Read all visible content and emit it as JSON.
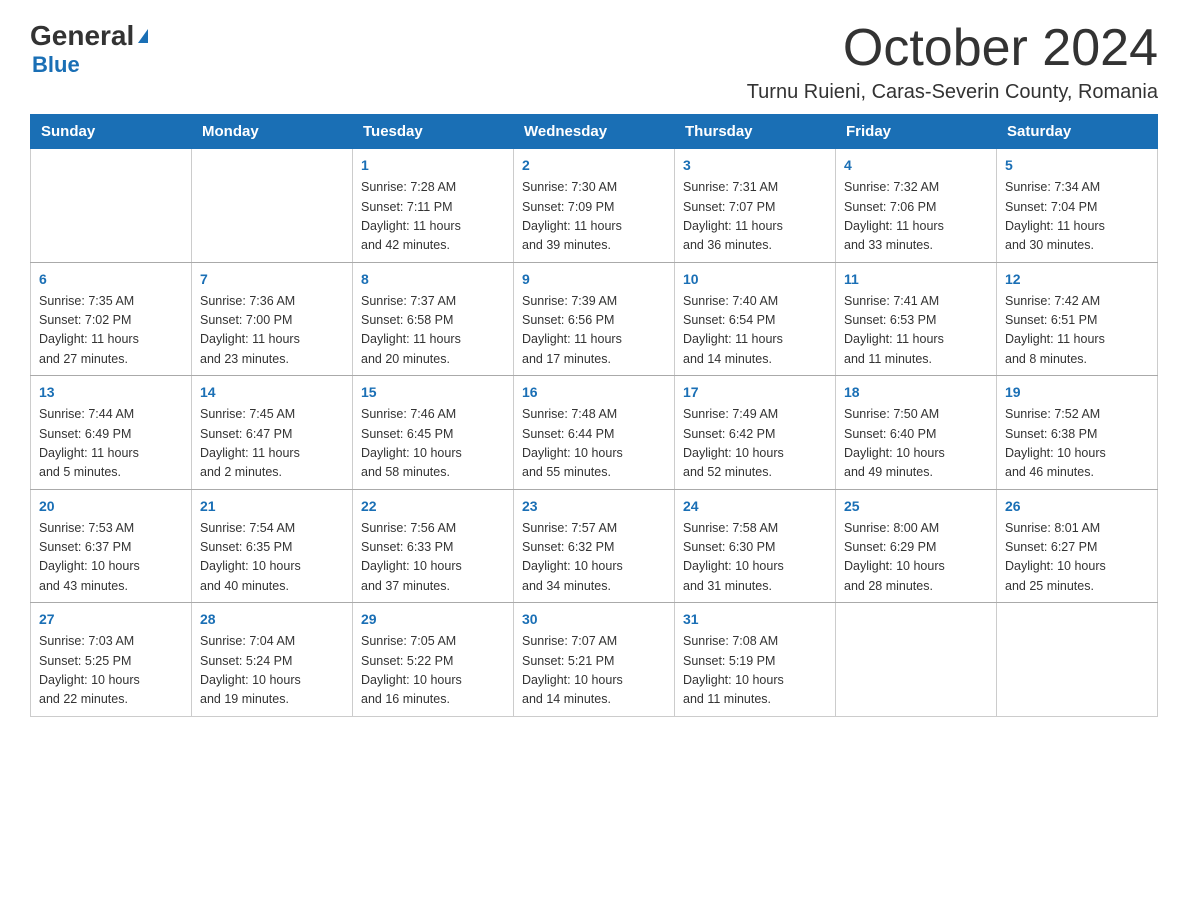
{
  "logo": {
    "general": "General",
    "triangle": "",
    "blue": "Blue"
  },
  "title": {
    "month": "October 2024",
    "location": "Turnu Ruieni, Caras-Severin County, Romania"
  },
  "weekdays": [
    "Sunday",
    "Monday",
    "Tuesday",
    "Wednesday",
    "Thursday",
    "Friday",
    "Saturday"
  ],
  "weeks": [
    [
      {
        "day": "",
        "info": ""
      },
      {
        "day": "",
        "info": ""
      },
      {
        "day": "1",
        "info": "Sunrise: 7:28 AM\nSunset: 7:11 PM\nDaylight: 11 hours\nand 42 minutes."
      },
      {
        "day": "2",
        "info": "Sunrise: 7:30 AM\nSunset: 7:09 PM\nDaylight: 11 hours\nand 39 minutes."
      },
      {
        "day": "3",
        "info": "Sunrise: 7:31 AM\nSunset: 7:07 PM\nDaylight: 11 hours\nand 36 minutes."
      },
      {
        "day": "4",
        "info": "Sunrise: 7:32 AM\nSunset: 7:06 PM\nDaylight: 11 hours\nand 33 minutes."
      },
      {
        "day": "5",
        "info": "Sunrise: 7:34 AM\nSunset: 7:04 PM\nDaylight: 11 hours\nand 30 minutes."
      }
    ],
    [
      {
        "day": "6",
        "info": "Sunrise: 7:35 AM\nSunset: 7:02 PM\nDaylight: 11 hours\nand 27 minutes."
      },
      {
        "day": "7",
        "info": "Sunrise: 7:36 AM\nSunset: 7:00 PM\nDaylight: 11 hours\nand 23 minutes."
      },
      {
        "day": "8",
        "info": "Sunrise: 7:37 AM\nSunset: 6:58 PM\nDaylight: 11 hours\nand 20 minutes."
      },
      {
        "day": "9",
        "info": "Sunrise: 7:39 AM\nSunset: 6:56 PM\nDaylight: 11 hours\nand 17 minutes."
      },
      {
        "day": "10",
        "info": "Sunrise: 7:40 AM\nSunset: 6:54 PM\nDaylight: 11 hours\nand 14 minutes."
      },
      {
        "day": "11",
        "info": "Sunrise: 7:41 AM\nSunset: 6:53 PM\nDaylight: 11 hours\nand 11 minutes."
      },
      {
        "day": "12",
        "info": "Sunrise: 7:42 AM\nSunset: 6:51 PM\nDaylight: 11 hours\nand 8 minutes."
      }
    ],
    [
      {
        "day": "13",
        "info": "Sunrise: 7:44 AM\nSunset: 6:49 PM\nDaylight: 11 hours\nand 5 minutes."
      },
      {
        "day": "14",
        "info": "Sunrise: 7:45 AM\nSunset: 6:47 PM\nDaylight: 11 hours\nand 2 minutes."
      },
      {
        "day": "15",
        "info": "Sunrise: 7:46 AM\nSunset: 6:45 PM\nDaylight: 10 hours\nand 58 minutes."
      },
      {
        "day": "16",
        "info": "Sunrise: 7:48 AM\nSunset: 6:44 PM\nDaylight: 10 hours\nand 55 minutes."
      },
      {
        "day": "17",
        "info": "Sunrise: 7:49 AM\nSunset: 6:42 PM\nDaylight: 10 hours\nand 52 minutes."
      },
      {
        "day": "18",
        "info": "Sunrise: 7:50 AM\nSunset: 6:40 PM\nDaylight: 10 hours\nand 49 minutes."
      },
      {
        "day": "19",
        "info": "Sunrise: 7:52 AM\nSunset: 6:38 PM\nDaylight: 10 hours\nand 46 minutes."
      }
    ],
    [
      {
        "day": "20",
        "info": "Sunrise: 7:53 AM\nSunset: 6:37 PM\nDaylight: 10 hours\nand 43 minutes."
      },
      {
        "day": "21",
        "info": "Sunrise: 7:54 AM\nSunset: 6:35 PM\nDaylight: 10 hours\nand 40 minutes."
      },
      {
        "day": "22",
        "info": "Sunrise: 7:56 AM\nSunset: 6:33 PM\nDaylight: 10 hours\nand 37 minutes."
      },
      {
        "day": "23",
        "info": "Sunrise: 7:57 AM\nSunset: 6:32 PM\nDaylight: 10 hours\nand 34 minutes."
      },
      {
        "day": "24",
        "info": "Sunrise: 7:58 AM\nSunset: 6:30 PM\nDaylight: 10 hours\nand 31 minutes."
      },
      {
        "day": "25",
        "info": "Sunrise: 8:00 AM\nSunset: 6:29 PM\nDaylight: 10 hours\nand 28 minutes."
      },
      {
        "day": "26",
        "info": "Sunrise: 8:01 AM\nSunset: 6:27 PM\nDaylight: 10 hours\nand 25 minutes."
      }
    ],
    [
      {
        "day": "27",
        "info": "Sunrise: 7:03 AM\nSunset: 5:25 PM\nDaylight: 10 hours\nand 22 minutes."
      },
      {
        "day": "28",
        "info": "Sunrise: 7:04 AM\nSunset: 5:24 PM\nDaylight: 10 hours\nand 19 minutes."
      },
      {
        "day": "29",
        "info": "Sunrise: 7:05 AM\nSunset: 5:22 PM\nDaylight: 10 hours\nand 16 minutes."
      },
      {
        "day": "30",
        "info": "Sunrise: 7:07 AM\nSunset: 5:21 PM\nDaylight: 10 hours\nand 14 minutes."
      },
      {
        "day": "31",
        "info": "Sunrise: 7:08 AM\nSunset: 5:19 PM\nDaylight: 10 hours\nand 11 minutes."
      },
      {
        "day": "",
        "info": ""
      },
      {
        "day": "",
        "info": ""
      }
    ]
  ]
}
